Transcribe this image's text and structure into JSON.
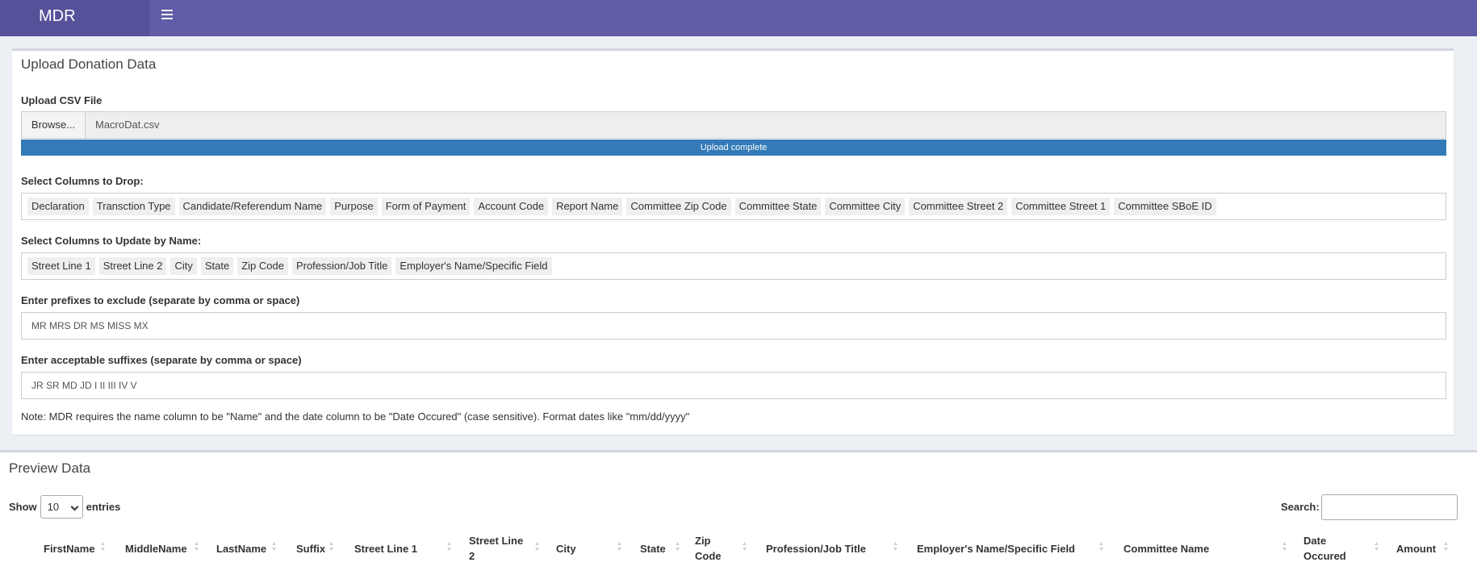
{
  "app": {
    "brand": "MDR"
  },
  "upload_box": {
    "title": "Upload Donation Data",
    "csv_label": "Upload CSV File",
    "browse_label": "Browse...",
    "file_name": "MacroDat.csv",
    "progress_text": "Upload complete",
    "progress_fraction": 1.0,
    "drop_label": "Select Columns to Drop:",
    "drop_columns": [
      "Declaration",
      "Transction Type",
      "Candidate/Referendum Name",
      "Purpose",
      "Form of Payment",
      "Account Code",
      "Report Name",
      "Committee Zip Code",
      "Committee State",
      "Committee City",
      "Committee Street 2",
      "Committee Street 1",
      "Committee SBoE ID"
    ],
    "update_label": "Select Columns to Update by Name:",
    "update_columns": [
      "Street Line 1",
      "Street Line 2",
      "City",
      "State",
      "Zip Code",
      "Profession/Job Title",
      "Employer's Name/Specific Field"
    ],
    "prefix_label": "Enter prefixes to exclude (separate by comma or space)",
    "prefix_value": "MR MRS DR MS MISS MX",
    "suffix_label": "Enter acceptable suffixes (separate by comma or space)",
    "suffix_value": "JR SR MD JD I II III IV V",
    "note": "Note: MDR requires the name column to be \"Name\" and the date column to be \"Date Occured\" (case sensitive). Format dates like \"mm/dd/yyyy\""
  },
  "preview_box": {
    "title": "Preview Data",
    "show_label": "Show",
    "entries_value": "10",
    "entries_label": "entries",
    "search_label": "Search:",
    "columns": [
      "FirstName",
      "MiddleName",
      "LastName",
      "Suffix",
      "Street Line 1",
      "Street Line 2",
      "City",
      "State",
      "Zip Code",
      "Profession/Job Title",
      "Employer's Name/Specific Field",
      "Committee Name",
      "Date Occured",
      "Amount"
    ]
  },
  "colors": {
    "header": "#605ca8",
    "brand_bg": "#555299",
    "progress": "#337ab7"
  },
  "icons": {
    "menu": "hamburger-icon"
  }
}
